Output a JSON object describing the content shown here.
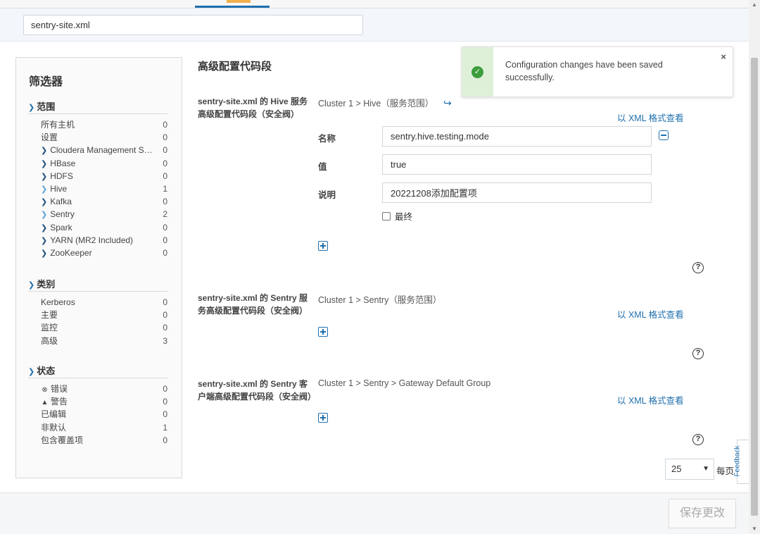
{
  "search": {
    "value": "sentry-site.xml"
  },
  "filters": {
    "title": "筛选器",
    "scope": {
      "title": "范围",
      "items": [
        {
          "label": "所有主机",
          "count": "0"
        },
        {
          "label": "设置",
          "count": "0"
        },
        {
          "label": "Cloudera Management Ser...",
          "count": "0"
        },
        {
          "label": "HBase",
          "count": "0"
        },
        {
          "label": "HDFS",
          "count": "0"
        },
        {
          "label": "Hive",
          "count": "1"
        },
        {
          "label": "Kafka",
          "count": "0"
        },
        {
          "label": "Sentry",
          "count": "2"
        },
        {
          "label": "Spark",
          "count": "0"
        },
        {
          "label": "YARN (MR2 Included)",
          "count": "0"
        },
        {
          "label": "ZooKeeper",
          "count": "0"
        }
      ]
    },
    "category": {
      "title": "类别",
      "items": [
        {
          "label": "Kerberos",
          "count": "0"
        },
        {
          "label": "主要",
          "count": "0"
        },
        {
          "label": "监控",
          "count": "0"
        },
        {
          "label": "高级",
          "count": "3"
        }
      ]
    },
    "status": {
      "title": "状态",
      "items": [
        {
          "label": "错误",
          "count": "0"
        },
        {
          "label": "警告",
          "count": "0"
        },
        {
          "label": "已编辑",
          "count": "0"
        },
        {
          "label": "非默认",
          "count": "1"
        },
        {
          "label": "包含覆盖项",
          "count": "0"
        }
      ]
    }
  },
  "main": {
    "section_title": "高级配置代码段",
    "blocks": [
      {
        "label": "sentry-site.xml 的 Hive 服务高级配置代码段（安全阀）",
        "scope": "Cluster 1 > Hive（服务范围）",
        "xml_link": "以 XML 格式查看",
        "fields": {
          "name_label": "名称",
          "name_value": "sentry.hive.testing.mode",
          "value_label": "值",
          "value_value": "true",
          "desc_label": "说明",
          "desc_value": "20221208添加配置项",
          "final_label": "最终"
        }
      },
      {
        "label": "sentry-site.xml 的 Sentry 服务高级配置代码段（安全阀）",
        "scope": "Cluster 1 > Sentry（服务范围）",
        "xml_link": "以 XML 格式查看"
      },
      {
        "label": "sentry-site.xml 的 Sentry 客户端高级配置代码段（安全阀）",
        "scope": "Cluster 1 > Sentry > Gateway Default Group",
        "xml_link": "以 XML 格式查看"
      }
    ]
  },
  "pagination": {
    "per_page_value": "25",
    "per_page_label": "每页"
  },
  "footer": {
    "save_label": "保存更改"
  },
  "feedback": {
    "label": "Feedback"
  },
  "toast": {
    "message": "Configuration changes have been saved successfully.",
    "close": "×"
  },
  "colors": {
    "accent": "#1f6fad",
    "success": "#3c9d3c",
    "success_bg": "#dff0d8"
  }
}
